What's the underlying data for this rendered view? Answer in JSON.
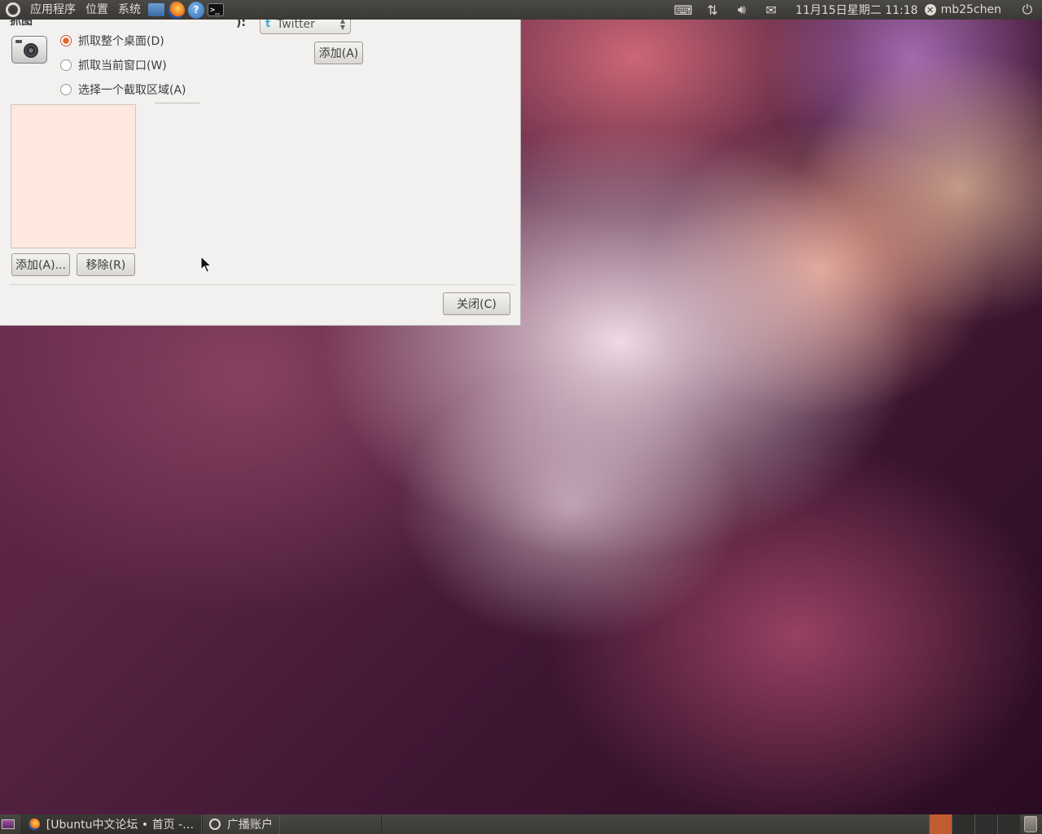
{
  "top_panel": {
    "menus": [
      "应用程序",
      "位置",
      "系统"
    ],
    "launchers": {
      "help_glyph": "?",
      "terminal_glyph": ">_"
    },
    "clock": "11月15日星期二 11:18",
    "user": "mb25chen",
    "user_status_glyph": "✕"
  },
  "dialog": {
    "clipped_label": "抓图",
    "capture_options": [
      {
        "label": "抓取整个桌面(D)",
        "checked": true
      },
      {
        "label": "抓取当前窗口(W)",
        "checked": false
      },
      {
        "label": "选择一个截取区域(A)",
        "checked": false
      }
    ],
    "provider_label": "):",
    "provider_value": "Twitter",
    "add_account_button": "添加(A)",
    "add_button": "添加(A)...",
    "remove_button": "移除(R)",
    "close_button": "关闭(C)"
  },
  "bottom_panel": {
    "tasks": [
      {
        "label": "[Ubuntu中文论坛 • 首页 - ...",
        "icon": "firefox-icon",
        "active": true
      },
      {
        "label": "广播账户",
        "icon": "broadcast-icon",
        "active": false
      }
    ],
    "workspace_count": 4,
    "active_workspace": 1
  },
  "colors": {
    "panel": "#3a3936",
    "dialog_bg": "#f2f1f0",
    "accent": "#e0672e",
    "list_bg": "#ffe8de"
  }
}
